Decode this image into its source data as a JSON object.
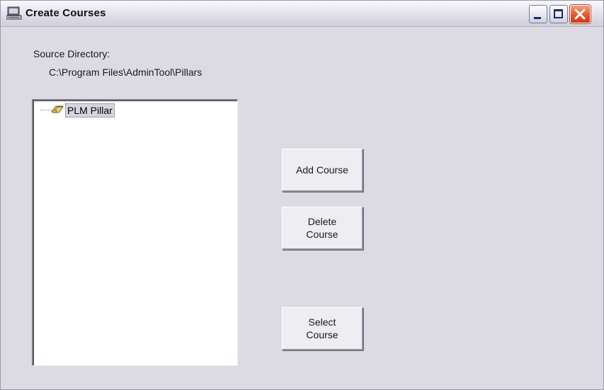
{
  "window": {
    "title": "Create Courses",
    "icon": "computer-icon",
    "controls": {
      "minimize": "minimize-icon",
      "maximize": "maximize-icon",
      "close": "close-icon"
    }
  },
  "source": {
    "label": "Source Directory:",
    "path": "C:\\Program Files\\AdminTool\\Pillars"
  },
  "tree": {
    "items": [
      {
        "label": "PLM Pillar",
        "icon": "pillar-folder-icon",
        "selected": true
      }
    ]
  },
  "buttons": {
    "add": "Add   Course",
    "delete": "Delete\nCourse",
    "select": "Select\nCourse"
  },
  "colors": {
    "window_bg": "#dcdbe3",
    "close_button": "#e6552a",
    "title_text": "#101010"
  }
}
